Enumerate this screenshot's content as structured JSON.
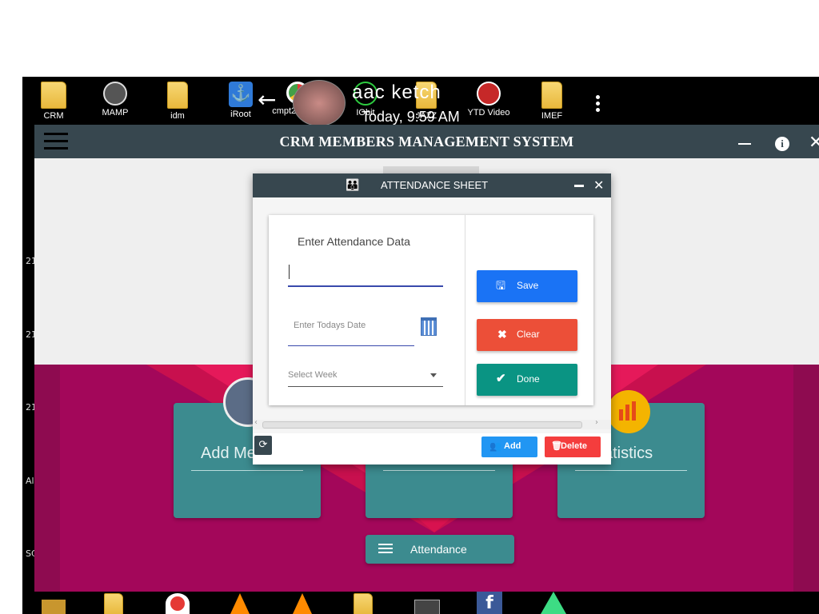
{
  "desktop_icons": [
    {
      "label": "CRM",
      "icon": "crm-folder-icon"
    },
    {
      "label": "MAMP",
      "icon": "mamp-icon"
    },
    {
      "label": "idm",
      "icon": "folder-icon"
    },
    {
      "label": "iRoot",
      "icon": "iroot-icon"
    },
    {
      "label": "cmpt225_4...",
      "icon": "chrome-icon"
    },
    {
      "label": "IObit",
      "icon": "iobit-icon"
    },
    {
      "label": "JAZZ",
      "icon": "folder-icon"
    },
    {
      "label": "YTD Video",
      "icon": "ytd-icon"
    },
    {
      "label": "IMEF",
      "icon": "folder-icon"
    }
  ],
  "overlay_text": {
    "app_name": "aac ketch",
    "time": "Today, 9:59 AM"
  },
  "left_numbers": [
    "21",
    "21",
    "21",
    "Al",
    "SC"
  ],
  "app": {
    "title": "CRM MEMBERS MANAGEMENT SYSTEM",
    "cards": [
      {
        "label": "Add Me"
      },
      {
        "label": ""
      },
      {
        "label": "atistics"
      }
    ],
    "attendance_label": "Attendance"
  },
  "dialog": {
    "title": "ATTENDANCE SHEET",
    "heading": "Enter Attendance Data",
    "name_value": "",
    "date_placeholder": "Enter Todays Date",
    "week_placeholder": "Select Week",
    "save_label": "Save",
    "clear_label": "Clear",
    "done_label": "Done",
    "add_label": "Add",
    "delete_label": "Delete"
  },
  "colors": {
    "header": "#37474f",
    "magenta": "#a3075a",
    "teal_card": "#3c8b8f",
    "save": "#1a73f5",
    "clear": "#ec4f38",
    "done": "#0a9483",
    "add": "#2196f3",
    "delete": "#f43d3d"
  },
  "taskbar_icons": [
    "image-viewer-icon",
    "folder-icon",
    "airtel-icon",
    "vlc-icon",
    "vlc-icon",
    "folder-icon",
    "film-icon",
    "facebook-icon",
    "android-studio-icon"
  ]
}
